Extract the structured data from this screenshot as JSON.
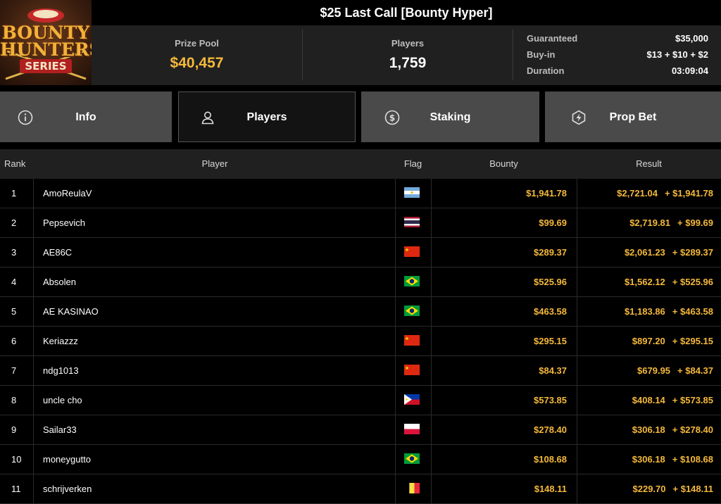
{
  "logo": {
    "line1": "BOUNTY",
    "line2": "HUNTERS",
    "line3": "SERIES"
  },
  "title": "$25 Last Call [Bounty Hyper]",
  "stats": {
    "prize_pool": {
      "label": "Prize Pool",
      "value": "$40,457"
    },
    "players": {
      "label": "Players",
      "value": "1,759"
    },
    "details": [
      {
        "label": "Guaranteed",
        "value": "$35,000"
      },
      {
        "label": "Buy-in",
        "value": "$13 + $10 + $2"
      },
      {
        "label": "Duration",
        "value": "03:09:04"
      }
    ]
  },
  "tabs": [
    {
      "label": "Info",
      "icon": "info-icon",
      "active": false
    },
    {
      "label": "Players",
      "icon": "user-icon",
      "active": true
    },
    {
      "label": "Staking",
      "icon": "dollar-coin-icon",
      "active": false
    },
    {
      "label": "Prop Bet",
      "icon": "lightning-badge-icon",
      "active": false
    }
  ],
  "table": {
    "headers": {
      "rank": "Rank",
      "player": "Player",
      "flag": "Flag",
      "bounty": "Bounty",
      "result": "Result"
    },
    "rows": [
      {
        "rank": "1",
        "player": "AmoReulaV",
        "flag": "argentina",
        "bounty": "$1,941.78",
        "result": "$2,721.04",
        "result_bounty": "+ $1,941.78"
      },
      {
        "rank": "2",
        "player": "Pepsevich",
        "flag": "thailand",
        "bounty": "$99.69",
        "result": "$2,719.81",
        "result_bounty": "+ $99.69"
      },
      {
        "rank": "3",
        "player": "AE86C",
        "flag": "china",
        "bounty": "$289.37",
        "result": "$2,061.23",
        "result_bounty": "+ $289.37"
      },
      {
        "rank": "4",
        "player": "Absolen",
        "flag": "brazil",
        "bounty": "$525.96",
        "result": "$1,562.12",
        "result_bounty": "+ $525.96"
      },
      {
        "rank": "5",
        "player": "AE KASINAO",
        "flag": "brazil",
        "bounty": "$463.58",
        "result": "$1,183.86",
        "result_bounty": "+ $463.58"
      },
      {
        "rank": "6",
        "player": "Keriazzz",
        "flag": "china",
        "bounty": "$295.15",
        "result": "$897.20",
        "result_bounty": "+ $295.15"
      },
      {
        "rank": "7",
        "player": "ndg1013",
        "flag": "china",
        "bounty": "$84.37",
        "result": "$679.95",
        "result_bounty": "+ $84.37"
      },
      {
        "rank": "8",
        "player": "uncle cho",
        "flag": "philippines",
        "bounty": "$573.85",
        "result": "$408.14",
        "result_bounty": "+ $573.85"
      },
      {
        "rank": "9",
        "player": "Sailar33",
        "flag": "poland",
        "bounty": "$278.40",
        "result": "$306.18",
        "result_bounty": "+ $278.40"
      },
      {
        "rank": "10",
        "player": "moneygutto",
        "flag": "brazil",
        "bounty": "$108.68",
        "result": "$306.18",
        "result_bounty": "+ $108.68"
      },
      {
        "rank": "11",
        "player": "schrijverken",
        "flag": "belgium",
        "bounty": "$148.11",
        "result": "$229.70",
        "result_bounty": "+ $148.11"
      }
    ]
  },
  "colors": {
    "accent": "#f5b93b",
    "bg": "#000000",
    "panel": "#202020",
    "tab": "#4a4a4a",
    "tab_active": "#131313"
  }
}
